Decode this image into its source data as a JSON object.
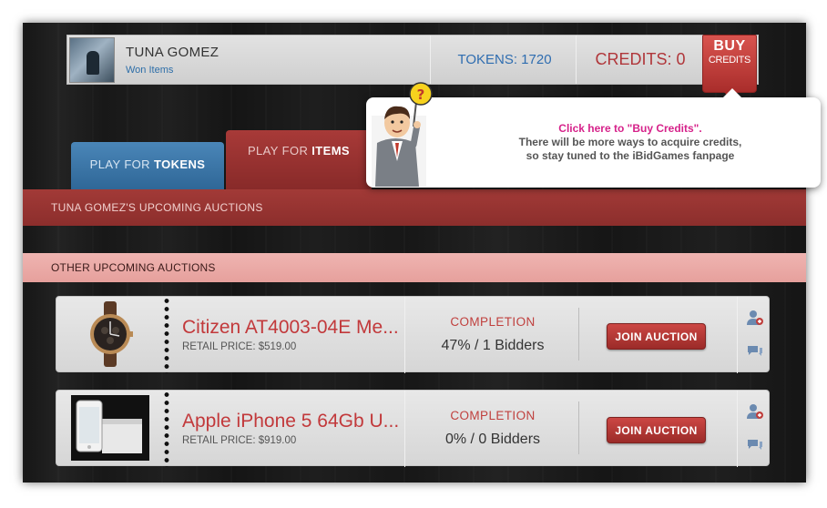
{
  "header": {
    "username": "TUNA GOMEZ",
    "won_items": "Won Items",
    "tokens": "TOKENS: 1720",
    "credits": "CREDITS: 0",
    "buy_line1": "BUY",
    "buy_line2": "CREDITS"
  },
  "tabs": {
    "tokens_prefix": "PLAY FOR ",
    "tokens_bold": "TOKENS",
    "items_prefix": "PLAY FOR ",
    "items_bold": "ITEMS"
  },
  "sections": {
    "upcoming": "TUNA GOMEZ'S UPCOMING AUCTIONS",
    "other": "OTHER UPCOMING AUCTIONS"
  },
  "auctions": [
    {
      "title": "Citizen AT4003-04E Me...",
      "retail": "RETAIL PRICE: $519.00",
      "completion_label": "COMPLETION",
      "completion_value": "47% / 1 Bidders",
      "join_label": "JOIN AUCTION"
    },
    {
      "title": "Apple iPhone 5 64Gb U...",
      "retail": "RETAIL PRICE: $919.00",
      "completion_label": "COMPLETION",
      "completion_value": "0% / 0 Bidders",
      "join_label": "JOIN AUCTION"
    }
  ],
  "tooltip": {
    "line1": "Click here to  \"Buy Credits\".",
    "line2": "There will be more ways to acquire credits,",
    "line3": "so stay tuned to the iBidGames fanpage"
  },
  "icons": {
    "add_user": "add-user-icon",
    "chat": "chat-icon"
  },
  "colors": {
    "accent_red": "#a83a38",
    "accent_blue": "#2f6db0",
    "tooltip_pink": "#d6228a"
  }
}
